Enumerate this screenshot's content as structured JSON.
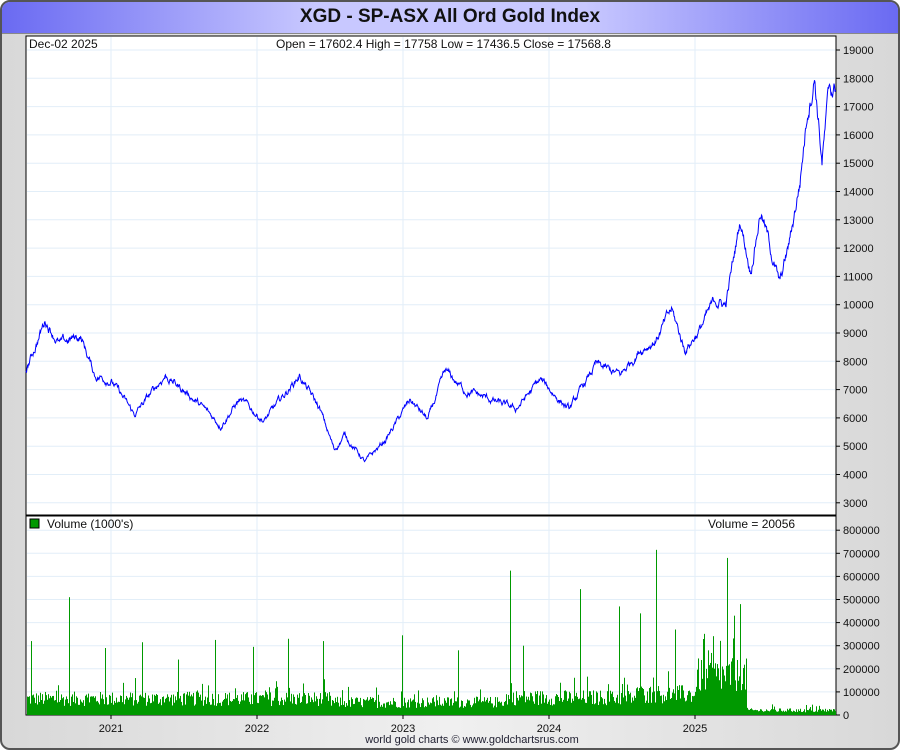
{
  "title": "XGD - SP-ASX All Ord Gold Index",
  "header": {
    "date": "Dec-02  2025",
    "ohlc": "Open = 17602.4   High = 17758   Low = 17436.5   Close = 17568.8"
  },
  "volume_panel": {
    "legend": "Volume (1000's)",
    "current": "Volume = 20056",
    "legend_color": "#009900"
  },
  "footer": "world gold charts © www.goldchartsrus.com",
  "chart_data": [
    {
      "type": "line",
      "name": "price",
      "color": "#0000ff",
      "ylim": [
        2500,
        19500
      ],
      "yticks": [
        3000,
        4000,
        5000,
        6000,
        7000,
        8000,
        9000,
        10000,
        11000,
        12000,
        13000,
        14000,
        15000,
        16000,
        17000,
        18000,
        19000
      ],
      "xticks": [
        "2021",
        "2022",
        "2023",
        "2024",
        "2025"
      ],
      "x": [
        2020.42,
        2020.55,
        2020.65,
        2020.79,
        2020.89,
        2021.0,
        2021.16,
        2021.37,
        2021.54,
        2021.75,
        2021.88,
        2022.05,
        2022.29,
        2022.43,
        2022.53,
        2022.6,
        2022.74,
        2022.88,
        2023.05,
        2023.17,
        2023.29,
        2023.42,
        2023.6,
        2023.77,
        2023.94,
        2024.14,
        2024.32,
        2024.49,
        2024.62,
        2024.73,
        2024.84,
        2024.93,
        2025.03,
        2025.14,
        2025.21,
        2025.31,
        2025.38,
        2025.45,
        2025.58,
        2025.65,
        2025.72,
        2025.77,
        2025.82,
        2025.87,
        2025.92,
        2025.97
      ],
      "y": [
        7700,
        9460,
        8600,
        8900,
        7500,
        7340,
        6100,
        7500,
        6800,
        5750,
        6640,
        5900,
        7500,
        6300,
        4860,
        5400,
        4440,
        5220,
        6640,
        5930,
        7620,
        6990,
        6640,
        6290,
        7340,
        6290,
        7870,
        7500,
        8400,
        8750,
        9810,
        8400,
        9100,
        10170,
        9990,
        13000,
        11230,
        13350,
        10700,
        12290,
        14400,
        16880,
        18120,
        15100,
        17590,
        17569
      ]
    },
    {
      "type": "bar",
      "name": "volume",
      "color": "#009900",
      "ylim": [
        0,
        800000
      ],
      "yticks": [
        0,
        100000,
        200000,
        300000,
        400000,
        500000,
        600000,
        700000,
        800000
      ],
      "baseline": [
        {
          "from": 2020.42,
          "to": 2022.5,
          "level": 70000
        },
        {
          "from": 2022.5,
          "to": 2023.7,
          "level": 55000
        },
        {
          "from": 2023.7,
          "to": 2024.6,
          "level": 75000
        },
        {
          "from": 2024.6,
          "to": 2025.0,
          "level": 90000
        },
        {
          "from": 2025.0,
          "to": 2025.35,
          "level": 170000
        },
        {
          "from": 2025.35,
          "to": 2025.97,
          "level": 20000
        }
      ],
      "spikes": [
        {
          "x": 2020.45,
          "v": 320000
        },
        {
          "x": 2020.71,
          "v": 510000
        },
        {
          "x": 2020.96,
          "v": 290000
        },
        {
          "x": 2021.21,
          "v": 315000
        },
        {
          "x": 2021.46,
          "v": 240000
        },
        {
          "x": 2021.71,
          "v": 325000
        },
        {
          "x": 2021.97,
          "v": 295000
        },
        {
          "x": 2022.21,
          "v": 330000
        },
        {
          "x": 2022.45,
          "v": 320000
        },
        {
          "x": 2022.99,
          "v": 345000
        },
        {
          "x": 2023.38,
          "v": 280000
        },
        {
          "x": 2023.73,
          "v": 625000
        },
        {
          "x": 2023.82,
          "v": 300000
        },
        {
          "x": 2024.21,
          "v": 545000
        },
        {
          "x": 2024.48,
          "v": 470000
        },
        {
          "x": 2024.62,
          "v": 440000
        },
        {
          "x": 2024.73,
          "v": 715000
        },
        {
          "x": 2024.86,
          "v": 370000
        },
        {
          "x": 2025.09,
          "v": 280000
        },
        {
          "x": 2025.22,
          "v": 680000
        },
        {
          "x": 2025.27,
          "v": 430000
        },
        {
          "x": 2025.31,
          "v": 480000
        }
      ]
    }
  ]
}
